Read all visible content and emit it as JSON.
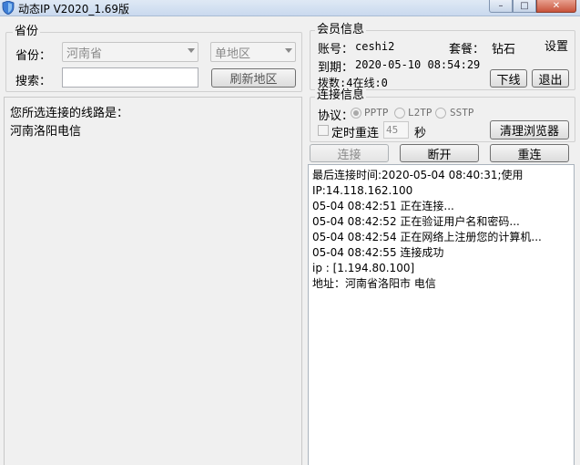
{
  "window": {
    "title": "动态IP V2020_1.69版",
    "min_glyph": "–",
    "max_glyph": "□",
    "close_glyph": "✕"
  },
  "province_group": {
    "label": "省份",
    "province_label": "省份：",
    "province_value": "河南省",
    "area_value": "单地区",
    "search_label": "搜索：",
    "search_value": "",
    "refresh_button": "刷新地区"
  },
  "route": {
    "prompt": "您所选连接的线路是：",
    "value": "河南洛阳电信"
  },
  "member": {
    "label": "会员信息",
    "account_label": "账号：",
    "account_value": "ceshi2",
    "plan_label": "套餐：",
    "plan_value": "钻石",
    "settings_link": "设置",
    "expire_label": "到期：",
    "expire_value": "2020-05-10 08:54:29",
    "dial_text": "拨数:4在线:0",
    "offline_button": "下线",
    "exit_button": "退出"
  },
  "connection": {
    "label": "连接信息",
    "protocol_label": "协议：",
    "protocols": [
      "PPTP",
      "L2TP",
      "SSTP"
    ],
    "selected_protocol": "PPTP",
    "timer_label": "定时重连",
    "timer_value": "45",
    "timer_unit": "秒",
    "clear_browser_button": "清理浏览器",
    "connect_button": "连接",
    "disconnect_button": "断开",
    "reconnect_button": "重连"
  },
  "log": [
    "最后连接时间:2020-05-04 08:40:31;使用",
    "IP:14.118.162.100",
    "05-04 08:42:51  正在连接...",
    "05-04 08:42:52  正在验证用户名和密码...",
    "05-04 08:42:54  正在网络上注册您的计算机...",
    "05-04 08:42:55  连接成功",
    "ip : [1.194.80.100]",
    "地址：河南省洛阳市 电信"
  ]
}
